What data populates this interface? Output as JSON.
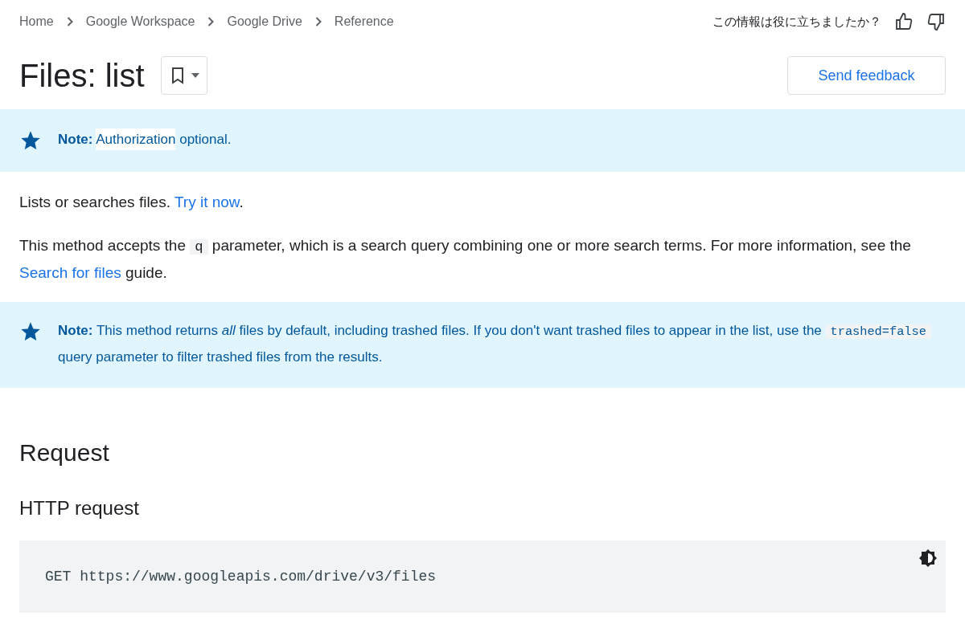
{
  "breadcrumbs": [
    "Home",
    "Google Workspace",
    "Google Drive",
    "Reference"
  ],
  "feedback_question": "この情報は役に立ちましたか？",
  "title": "Files: list",
  "send_feedback": "Send feedback",
  "notes": [
    {
      "label": "Note:",
      "segments": [
        {
          "kind": "highlight",
          "text": "Authorization"
        },
        {
          "kind": "text",
          "text": " optional."
        }
      ]
    },
    {
      "label": "Note:",
      "segments": [
        {
          "kind": "text",
          "text": "This method returns *all* files by default, including trashed files. If you don't want trashed files to appear in the list, use the "
        },
        {
          "kind": "code",
          "text": "trashed=false"
        },
        {
          "kind": "text",
          "text": " query parameter to filter trashed files from the results."
        }
      ]
    }
  ],
  "paragraphs": [
    [
      {
        "kind": "text",
        "text": "Lists or searches files. "
      },
      {
        "kind": "link",
        "text": "Try it now"
      },
      {
        "kind": "text",
        "text": "."
      }
    ],
    [
      {
        "kind": "text",
        "text": "This method accepts the "
      },
      {
        "kind": "code",
        "text": "q"
      },
      {
        "kind": "text",
        "text": " parameter, which is a search query combining one or more search terms. For more information, see the "
      },
      {
        "kind": "link",
        "text": "Search for files"
      },
      {
        "kind": "text",
        "text": " guide."
      }
    ]
  ],
  "section_heading": "Request",
  "subheading": "HTTP request",
  "code": "GET https://www.googleapis.com/drive/v3/files"
}
